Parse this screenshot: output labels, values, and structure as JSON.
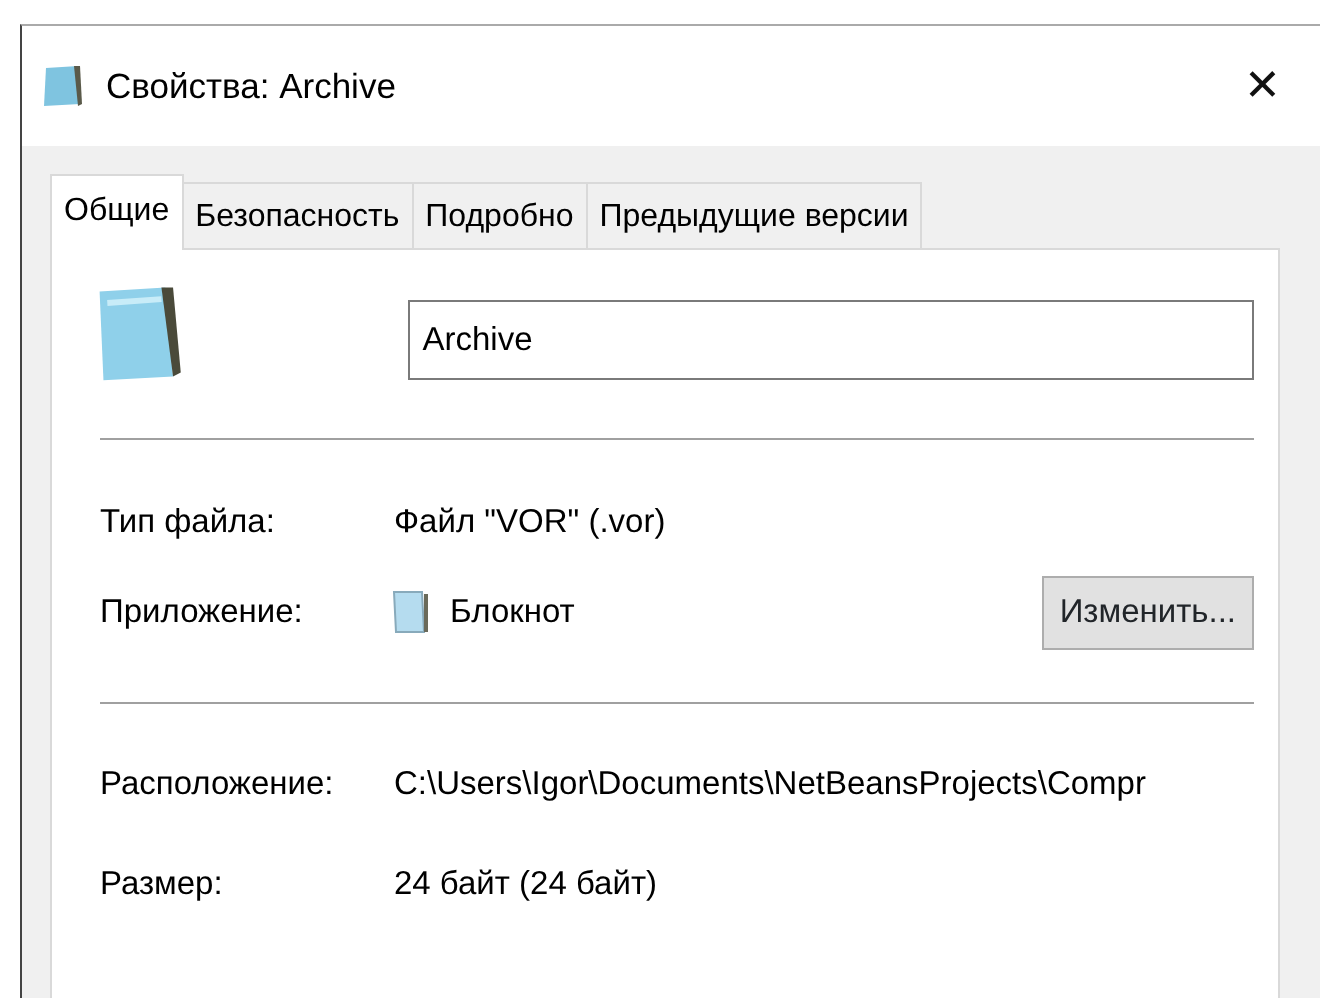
{
  "window": {
    "title": "Свойства: Archive",
    "close": "✕"
  },
  "tabs": [
    {
      "label": "Общие",
      "selected": true
    },
    {
      "label": "Безопасность",
      "selected": false
    },
    {
      "label": "Подробно",
      "selected": false
    },
    {
      "label": "Предыдущие версии",
      "selected": false
    }
  ],
  "name_field": {
    "value": "Archive"
  },
  "sections": [
    {
      "rows": [
        {
          "kind": "text",
          "label": "Тип файла:",
          "value": "Файл \"VOR\" (.vor)"
        },
        {
          "kind": "app",
          "label": "Приложение:",
          "value": "Блокнот",
          "button": "Изменить..."
        }
      ]
    },
    {
      "rows": [
        {
          "kind": "text",
          "label": "Расположение:",
          "value": "C:\\Users\\Igor\\Documents\\NetBeansProjects\\Compr"
        },
        {
          "kind": "text",
          "label": "Размер:",
          "value": "24 байт (24 байт)"
        }
      ]
    }
  ]
}
